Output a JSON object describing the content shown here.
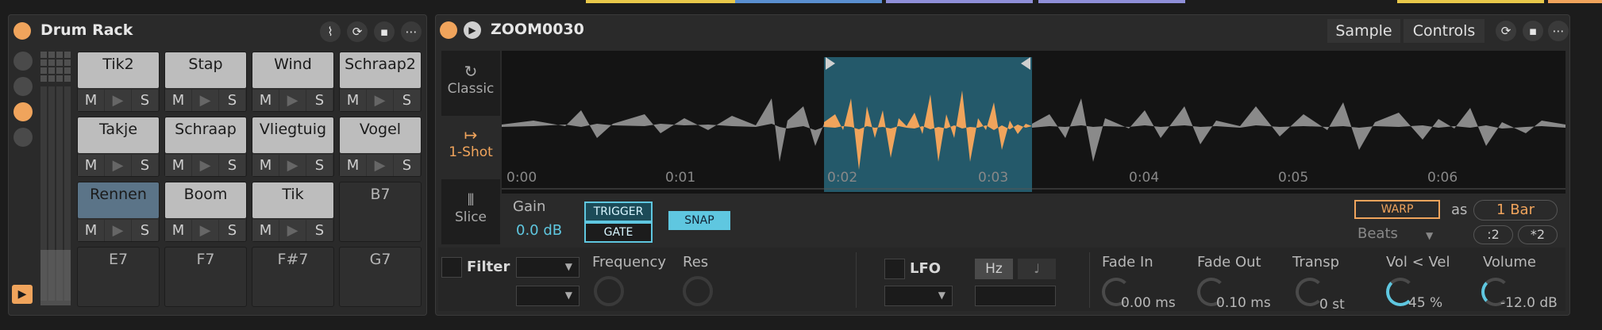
{
  "drum_rack": {
    "title": "Drum Rack",
    "pads": [
      {
        "name": "Tik2",
        "filled": true
      },
      {
        "name": "Stap",
        "filled": true
      },
      {
        "name": "Wind",
        "filled": true
      },
      {
        "name": "Schraap2",
        "filled": true
      },
      {
        "name": "Takje",
        "filled": true
      },
      {
        "name": "Schraap",
        "filled": true
      },
      {
        "name": "Vliegtuig",
        "filled": true
      },
      {
        "name": "Vogel",
        "filled": true
      },
      {
        "name": "Rennen",
        "filled": true,
        "selected": true
      },
      {
        "name": "Boom",
        "filled": true
      },
      {
        "name": "Tik",
        "filled": true
      },
      {
        "name": "B7",
        "filled": false
      },
      {
        "name": "E7",
        "filled": false
      },
      {
        "name": "F7",
        "filled": false
      },
      {
        "name": "F#7",
        "filled": false
      },
      {
        "name": "G7",
        "filled": false
      }
    ],
    "mute_label": "M",
    "play_label": "▶",
    "solo_label": "S"
  },
  "simpler": {
    "title": "ZOOM0030",
    "tabs": {
      "sample": "Sample",
      "controls": "Controls"
    },
    "modes": {
      "classic": "Classic",
      "one_shot": "1-Shot",
      "slice": "Slice"
    },
    "time_ticks": [
      "0:00",
      "0:01",
      "0:02",
      "0:03",
      "0:04",
      "0:05",
      "0:06"
    ],
    "gain_label": "Gain",
    "gain_value": "0.0 dB",
    "trigger_label": "TRIGGER",
    "gate_label": "GATE",
    "snap_label": "SNAP",
    "warp_label": "WARP",
    "as_label": "as",
    "bar_value": "1 Bar",
    "beats_label": "Beats",
    "half_label": ":2",
    "double_label": "*2",
    "filter_label": "Filter",
    "frequency_label": "Frequency",
    "res_label": "Res",
    "lfo_label": "LFO",
    "hz_label": "Hz",
    "fade_in_label": "Fade In",
    "fade_in_value": "0.00 ms",
    "fade_out_label": "Fade Out",
    "fade_out_value": "0.10 ms",
    "transp_label": "Transp",
    "transp_value": "0 st",
    "vol_vel_label": "Vol < Vel",
    "vol_vel_value": "45 %",
    "volume_label": "Volume",
    "volume_value": "-12.0 dB"
  },
  "colors": {
    "accent": "#f0a45c",
    "selection": "#2a5a6a",
    "blue": "#5fc7e0"
  }
}
